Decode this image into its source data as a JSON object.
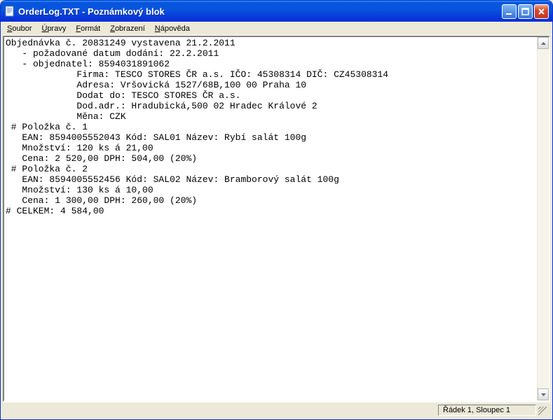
{
  "window": {
    "title": "OrderLog.TXT - Poznámkový blok"
  },
  "menu": {
    "items": [
      {
        "u": "S",
        "rest": "oubor"
      },
      {
        "u": "Ú",
        "rest": "pravy"
      },
      {
        "u": "F",
        "rest": "ormát"
      },
      {
        "u": "Z",
        "rest": "obrazení"
      },
      {
        "u": "N",
        "rest": "ápověda"
      }
    ]
  },
  "content": "Objednávka č. 20831249 vystavena 21.2.2011\n   - požadované datum dodání: 22.2.2011\n   - objednatel: 8594031891062\n             Firma: TESCO STORES ČR a.s. IČO: 45308314 DIČ: CZ45308314\n             Adresa: Vršovická 1527/68B,100 00 Praha 10\n             Dodat do: TESCO STORES ČR a.s.\n             Dod.adr.: Hradubická,500 02 Hradec Králové 2\n             Měna: CZK\n # Položka č. 1\n   EAN: 8594005552043 Kód: SAL01 Název: Rybí salát 100g\n   Množství: 120 ks á 21,00\n   Cena: 2 520,00 DPH: 504,00 (20%)\n # Položka č. 2\n   EAN: 8594005552456 Kód: SAL02 Název: Bramborový salát 100g\n   Množství: 130 ks á 10,00\n   Cena: 1 300,00 DPH: 260,00 (20%)\n# CELKEM: 4 584,00",
  "status": {
    "position": "Řádek 1, Sloupec 1"
  }
}
